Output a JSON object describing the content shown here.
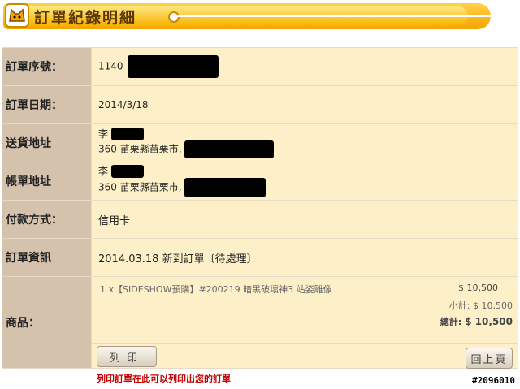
{
  "header": {
    "title": "訂單紀錄明細"
  },
  "rows": {
    "order_no": {
      "label": "訂單序號：",
      "value": "1140"
    },
    "order_date": {
      "label": "訂單日期：",
      "value": "2014/3/18"
    },
    "shipping": {
      "label": "送貨地址",
      "name": "李",
      "address": "360 苗栗縣苗栗市,"
    },
    "billing": {
      "label": "帳單地址",
      "name": "李",
      "address": "360 苗栗縣苗栗市,"
    },
    "payment": {
      "label": "付款方式：",
      "value": "信用卡"
    },
    "info": {
      "label": "訂單資訊",
      "value": "2014.03.18 新到訂單〔待處理〕"
    },
    "products": {
      "label": "商品：",
      "item": "1 x【SIDESHOW預購】#200219 暗黑破壞神3 站姿雕像",
      "item_price": "$ 10,500",
      "subtotal_label": "小計:",
      "subtotal_value": "$ 10,500",
      "total_label": "總計:",
      "total_value": "$ 10,500"
    }
  },
  "buttons": {
    "print": "列印",
    "back": "回上頁"
  },
  "note": "列印訂單在此可以列印出您的訂單",
  "watermark": "#2096010",
  "colors": {
    "label_bg": "#d4c2ad",
    "value_bg": "#fdf0c9",
    "note": "#c00000",
    "banner": "#f5a400"
  }
}
